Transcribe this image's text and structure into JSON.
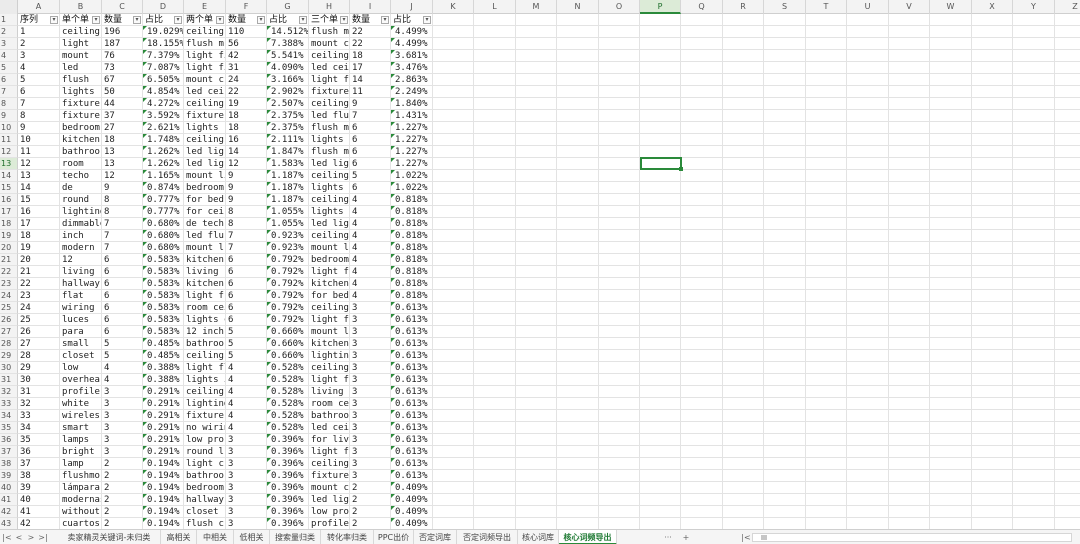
{
  "columns": [
    "A",
    "B",
    "C",
    "D",
    "E",
    "F",
    "G",
    "H",
    "I",
    "J",
    "K",
    "L",
    "M",
    "N",
    "O",
    "P",
    "Q",
    "R",
    "S",
    "T",
    "U",
    "V",
    "W",
    "X",
    "Y",
    "Z"
  ],
  "active_column": "P",
  "active_row": 13,
  "header": [
    "序列",
    "单个单",
    "数量",
    "占比",
    "两个单",
    "数量",
    "占比",
    "三个单",
    "数量",
    "占比"
  ],
  "rows": [
    [
      "1",
      "ceiling",
      "196",
      "19.029%",
      "ceiling",
      "110",
      "14.512%",
      "flush m",
      "22",
      "4.499%"
    ],
    [
      "2",
      "light",
      "187",
      "18.155%",
      "flush m",
      "56",
      "7.388%",
      "mount c",
      "22",
      "4.499%"
    ],
    [
      "3",
      "mount",
      "76",
      "7.379%",
      "light fi",
      "42",
      "5.541%",
      "ceiling",
      "18",
      "3.681%"
    ],
    [
      "4",
      "led",
      "73",
      "7.087%",
      "light fi",
      "31",
      "4.090%",
      "led cei",
      "17",
      "3.476%"
    ],
    [
      "5",
      "flush",
      "67",
      "6.505%",
      "mount c",
      "24",
      "3.166%",
      "light fi",
      "14",
      "2.863%"
    ],
    [
      "6",
      "lights",
      "50",
      "4.854%",
      "led cei",
      "22",
      "2.902%",
      "fixture",
      "11",
      "2.249%"
    ],
    [
      "7",
      "fixture",
      "44",
      "4.272%",
      "ceiling",
      "19",
      "2.507%",
      "ceiling",
      "9",
      "1.840%"
    ],
    [
      "8",
      "fixture",
      "37",
      "3.592%",
      "fixture",
      "18",
      "2.375%",
      "led flu",
      "7",
      "1.431%"
    ],
    [
      "9",
      "bedroom",
      "27",
      "2.621%",
      "lights",
      "18",
      "2.375%",
      "flush m",
      "6",
      "1.227%"
    ],
    [
      "10",
      "kitchen",
      "18",
      "1.748%",
      "ceiling",
      "16",
      "2.111%",
      "lights",
      "6",
      "1.227%"
    ],
    [
      "11",
      "bathroo",
      "13",
      "1.262%",
      "led lig",
      "14",
      "1.847%",
      "flush m",
      "6",
      "1.227%"
    ],
    [
      "12",
      "room",
      "13",
      "1.262%",
      "led lig",
      "12",
      "1.583%",
      "led lig",
      "6",
      "1.227%"
    ],
    [
      "13",
      "techo",
      "12",
      "1.165%",
      "mount li",
      "9",
      "1.187%",
      "ceiling",
      "5",
      "1.022%"
    ],
    [
      "14",
      "de",
      "9",
      "0.874%",
      "bedroom",
      "9",
      "1.187%",
      "lights",
      "6",
      "1.022%"
    ],
    [
      "15",
      "round",
      "8",
      "0.777%",
      "for bed",
      "9",
      "1.187%",
      "ceiling",
      "4",
      "0.818%"
    ],
    [
      "16",
      "lighting",
      "8",
      "0.777%",
      "for cei",
      "8",
      "1.055%",
      "lights",
      "4",
      "0.818%"
    ],
    [
      "17",
      "dimmable",
      "7",
      "0.680%",
      "de tech",
      "8",
      "1.055%",
      "led lig",
      "4",
      "0.818%"
    ],
    [
      "18",
      "inch",
      "7",
      "0.680%",
      "led flu",
      "7",
      "0.923%",
      "ceiling",
      "4",
      "0.818%"
    ],
    [
      "19",
      "modern",
      "7",
      "0.680%",
      "mount l",
      "7",
      "0.923%",
      "mount li",
      "4",
      "0.818%"
    ],
    [
      "20",
      "12",
      "6",
      "0.583%",
      "kitchen",
      "6",
      "0.792%",
      "bedroom",
      "4",
      "0.818%"
    ],
    [
      "21",
      "living",
      "6",
      "0.583%",
      "living r",
      "6",
      "0.792%",
      "light fi",
      "4",
      "0.818%"
    ],
    [
      "22",
      "hallway",
      "6",
      "0.583%",
      "kitchen",
      "6",
      "0.792%",
      "kitchen",
      "4",
      "0.818%"
    ],
    [
      "23",
      "flat",
      "6",
      "0.583%",
      "light f",
      "6",
      "0.792%",
      "for bed",
      "4",
      "0.818%"
    ],
    [
      "24",
      "wiring",
      "6",
      "0.583%",
      "room cei",
      "6",
      "0.792%",
      "ceiling",
      "3",
      "0.613%"
    ],
    [
      "25",
      "luces",
      "6",
      "0.583%",
      "lights c",
      "6",
      "0.792%",
      "light fl",
      "3",
      "0.613%"
    ],
    [
      "26",
      "para",
      "6",
      "0.583%",
      "12 inch",
      "5",
      "0.660%",
      "mount l",
      "3",
      "0.613%"
    ],
    [
      "27",
      "small",
      "5",
      "0.485%",
      "bathroo",
      "5",
      "0.660%",
      "kitchen",
      "3",
      "0.613%"
    ],
    [
      "28",
      "closet",
      "5",
      "0.485%",
      "ceiling",
      "5",
      "0.660%",
      "lighting",
      "3",
      "0.613%"
    ],
    [
      "29",
      "low",
      "4",
      "0.388%",
      "light fl",
      "4",
      "0.528%",
      "ceiling",
      "3",
      "0.613%"
    ],
    [
      "30",
      "overhea",
      "4",
      "0.388%",
      "lights i",
      "4",
      "0.528%",
      "light f",
      "3",
      "0.613%"
    ],
    [
      "31",
      "profile",
      "3",
      "0.291%",
      "ceiling",
      "4",
      "0.528%",
      "living l",
      "3",
      "0.613%"
    ],
    [
      "32",
      "white",
      "3",
      "0.291%",
      "lighting",
      "4",
      "0.528%",
      "room cei",
      "3",
      "0.613%"
    ],
    [
      "33",
      "wireles",
      "3",
      "0.291%",
      "fixture",
      "4",
      "0.528%",
      "bathroo",
      "3",
      "0.613%"
    ],
    [
      "34",
      "smart",
      "3",
      "0.291%",
      "no wirin",
      "4",
      "0.528%",
      "led cei",
      "3",
      "0.613%"
    ],
    [
      "35",
      "lamps",
      "3",
      "0.291%",
      "low pro",
      "3",
      "0.396%",
      "for livi",
      "3",
      "0.613%"
    ],
    [
      "36",
      "bright",
      "3",
      "0.291%",
      "round l",
      "3",
      "0.396%",
      "light fi",
      "3",
      "0.613%"
    ],
    [
      "37",
      "lamp",
      "2",
      "0.194%",
      "light c",
      "3",
      "0.396%",
      "ceiling",
      "3",
      "0.613%"
    ],
    [
      "38",
      "flushmo",
      "2",
      "0.194%",
      "bathroo",
      "3",
      "0.396%",
      "fixture",
      "3",
      "0.613%"
    ],
    [
      "39",
      "lámpara",
      "2",
      "0.194%",
      "bedroom",
      "3",
      "0.396%",
      "mount c",
      "2",
      "0.409%"
    ],
    [
      "40",
      "modernas",
      "2",
      "0.194%",
      "hallway",
      "3",
      "0.396%",
      "led lig",
      "2",
      "0.409%"
    ],
    [
      "41",
      "without",
      "2",
      "0.194%",
      "closet",
      "3",
      "0.396%",
      "low pro",
      "2",
      "0.409%"
    ],
    [
      "42",
      "cuartos",
      "2",
      "0.194%",
      "flush c",
      "3",
      "0.396%",
      "profile",
      "2",
      "0.409%"
    ]
  ],
  "tabs": [
    {
      "label": "卖家精灵关键词-未归类",
      "active": false
    },
    {
      "label": "高相关",
      "active": false
    },
    {
      "label": "中相关",
      "active": false
    },
    {
      "label": "低相关",
      "active": false
    },
    {
      "label": "搜索量归类",
      "active": false
    },
    {
      "label": "转化率归类",
      "active": false
    },
    {
      "label": "PPC出价",
      "active": false
    },
    {
      "label": "否定词库",
      "active": false
    },
    {
      "label": "否定词频导出",
      "active": false
    },
    {
      "label": "核心词库",
      "active": false
    },
    {
      "label": "核心词频导出",
      "active": true
    }
  ],
  "tab_more": "···",
  "tab_add": "+",
  "nav": {
    "first": "|<",
    "prev": "<",
    "next": ">",
    "last": ">|"
  },
  "scroll_prev": "|<"
}
